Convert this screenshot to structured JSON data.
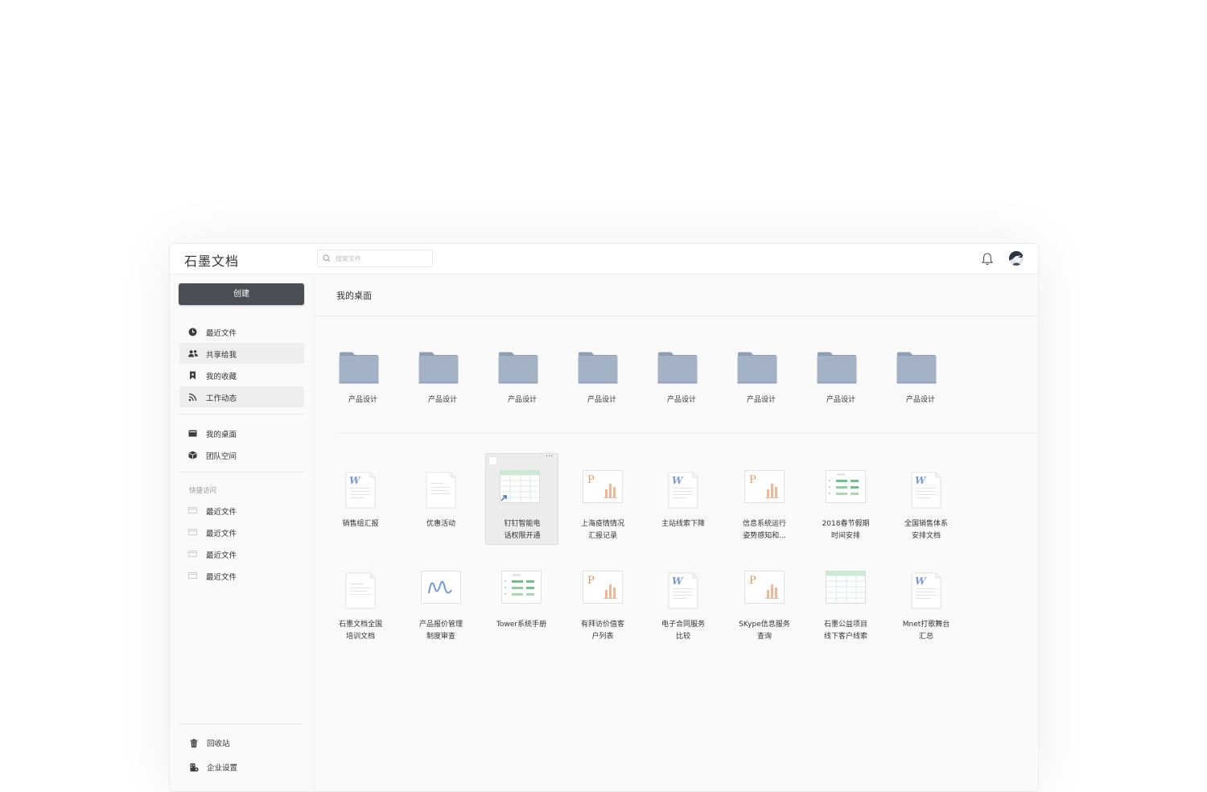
{
  "app": {
    "title": "石墨文档"
  },
  "search": {
    "placeholder": "搜索文件"
  },
  "sidebar": {
    "create_label": "创建",
    "nav": [
      {
        "label": "最近文件",
        "icon": "clock-icon"
      },
      {
        "label": "共享给我",
        "icon": "users-icon"
      },
      {
        "label": "我的收藏",
        "icon": "bookmark-icon"
      },
      {
        "label": "工作动态",
        "icon": "rss-icon"
      }
    ],
    "spaces": [
      {
        "label": "我的桌面",
        "icon": "desktop-icon"
      },
      {
        "label": "团队空间",
        "icon": "cube-icon"
      }
    ],
    "quick_access_label": "快捷访问",
    "quick_access": [
      {
        "label": "最近文件",
        "icon": "window-icon"
      },
      {
        "label": "最近文件",
        "icon": "window-icon"
      },
      {
        "label": "最近文件",
        "icon": "window-icon"
      },
      {
        "label": "最近文件",
        "icon": "window-icon"
      }
    ],
    "bottom": [
      {
        "label": "回收站",
        "icon": "trash-icon"
      },
      {
        "label": "企业设置",
        "icon": "enterprise-settings-icon"
      }
    ]
  },
  "main": {
    "title": "我的桌面",
    "folders": [
      {
        "name": "产品设计"
      },
      {
        "name": "产品设计"
      },
      {
        "name": "产品设计"
      },
      {
        "name": "产品设计"
      },
      {
        "name": "产品设计"
      },
      {
        "name": "产品设计"
      },
      {
        "name": "产品设计"
      },
      {
        "name": "产品设计"
      }
    ],
    "files_row1": [
      {
        "type": "word",
        "line1": "销售组汇报",
        "line2": ""
      },
      {
        "type": "doc",
        "line1": "优惠活动",
        "line2": ""
      },
      {
        "type": "sheet-shortcut",
        "line1": "钉钉智能电",
        "line2": "话权限开通",
        "selected": true
      },
      {
        "type": "ppt",
        "line1": "上海疫情情况",
        "line2": "汇报记录"
      },
      {
        "type": "word",
        "line1": "主站线索下降",
        "line2": ""
      },
      {
        "type": "ppt",
        "line1": "信息系统运行",
        "line2": "姿势感知和..."
      },
      {
        "type": "board",
        "line1": "2018春节假期",
        "line2": "时间安排"
      },
      {
        "type": "word",
        "line1": "全国销售体系",
        "line2": "安排文档"
      }
    ],
    "files_row2": [
      {
        "type": "doc",
        "line1": "石墨文档全国",
        "line2": "培训文档"
      },
      {
        "type": "mindmap",
        "line1": "产品报价管理",
        "line2": "制度审查"
      },
      {
        "type": "board",
        "line1": "Tower系统手册",
        "line2": ""
      },
      {
        "type": "ppt",
        "line1": "有拜访价值客",
        "line2": "户列表"
      },
      {
        "type": "word",
        "line1": "电子合同服务",
        "line2": "比较"
      },
      {
        "type": "ppt",
        "line1": "SKype信息服务",
        "line2": "查询"
      },
      {
        "type": "sheet",
        "line1": "石墨公益项目",
        "line2": "线下客户线索"
      },
      {
        "type": "word",
        "line1": "Mnet打歌舞台",
        "line2": "汇总"
      }
    ]
  },
  "colors": {
    "create_button": "#4a4e55",
    "folder": "#a4b2c6",
    "word_accent": "#6f8fc9",
    "ppt_accent": "#e07a45",
    "sheet_accent": "#5eb47a"
  }
}
